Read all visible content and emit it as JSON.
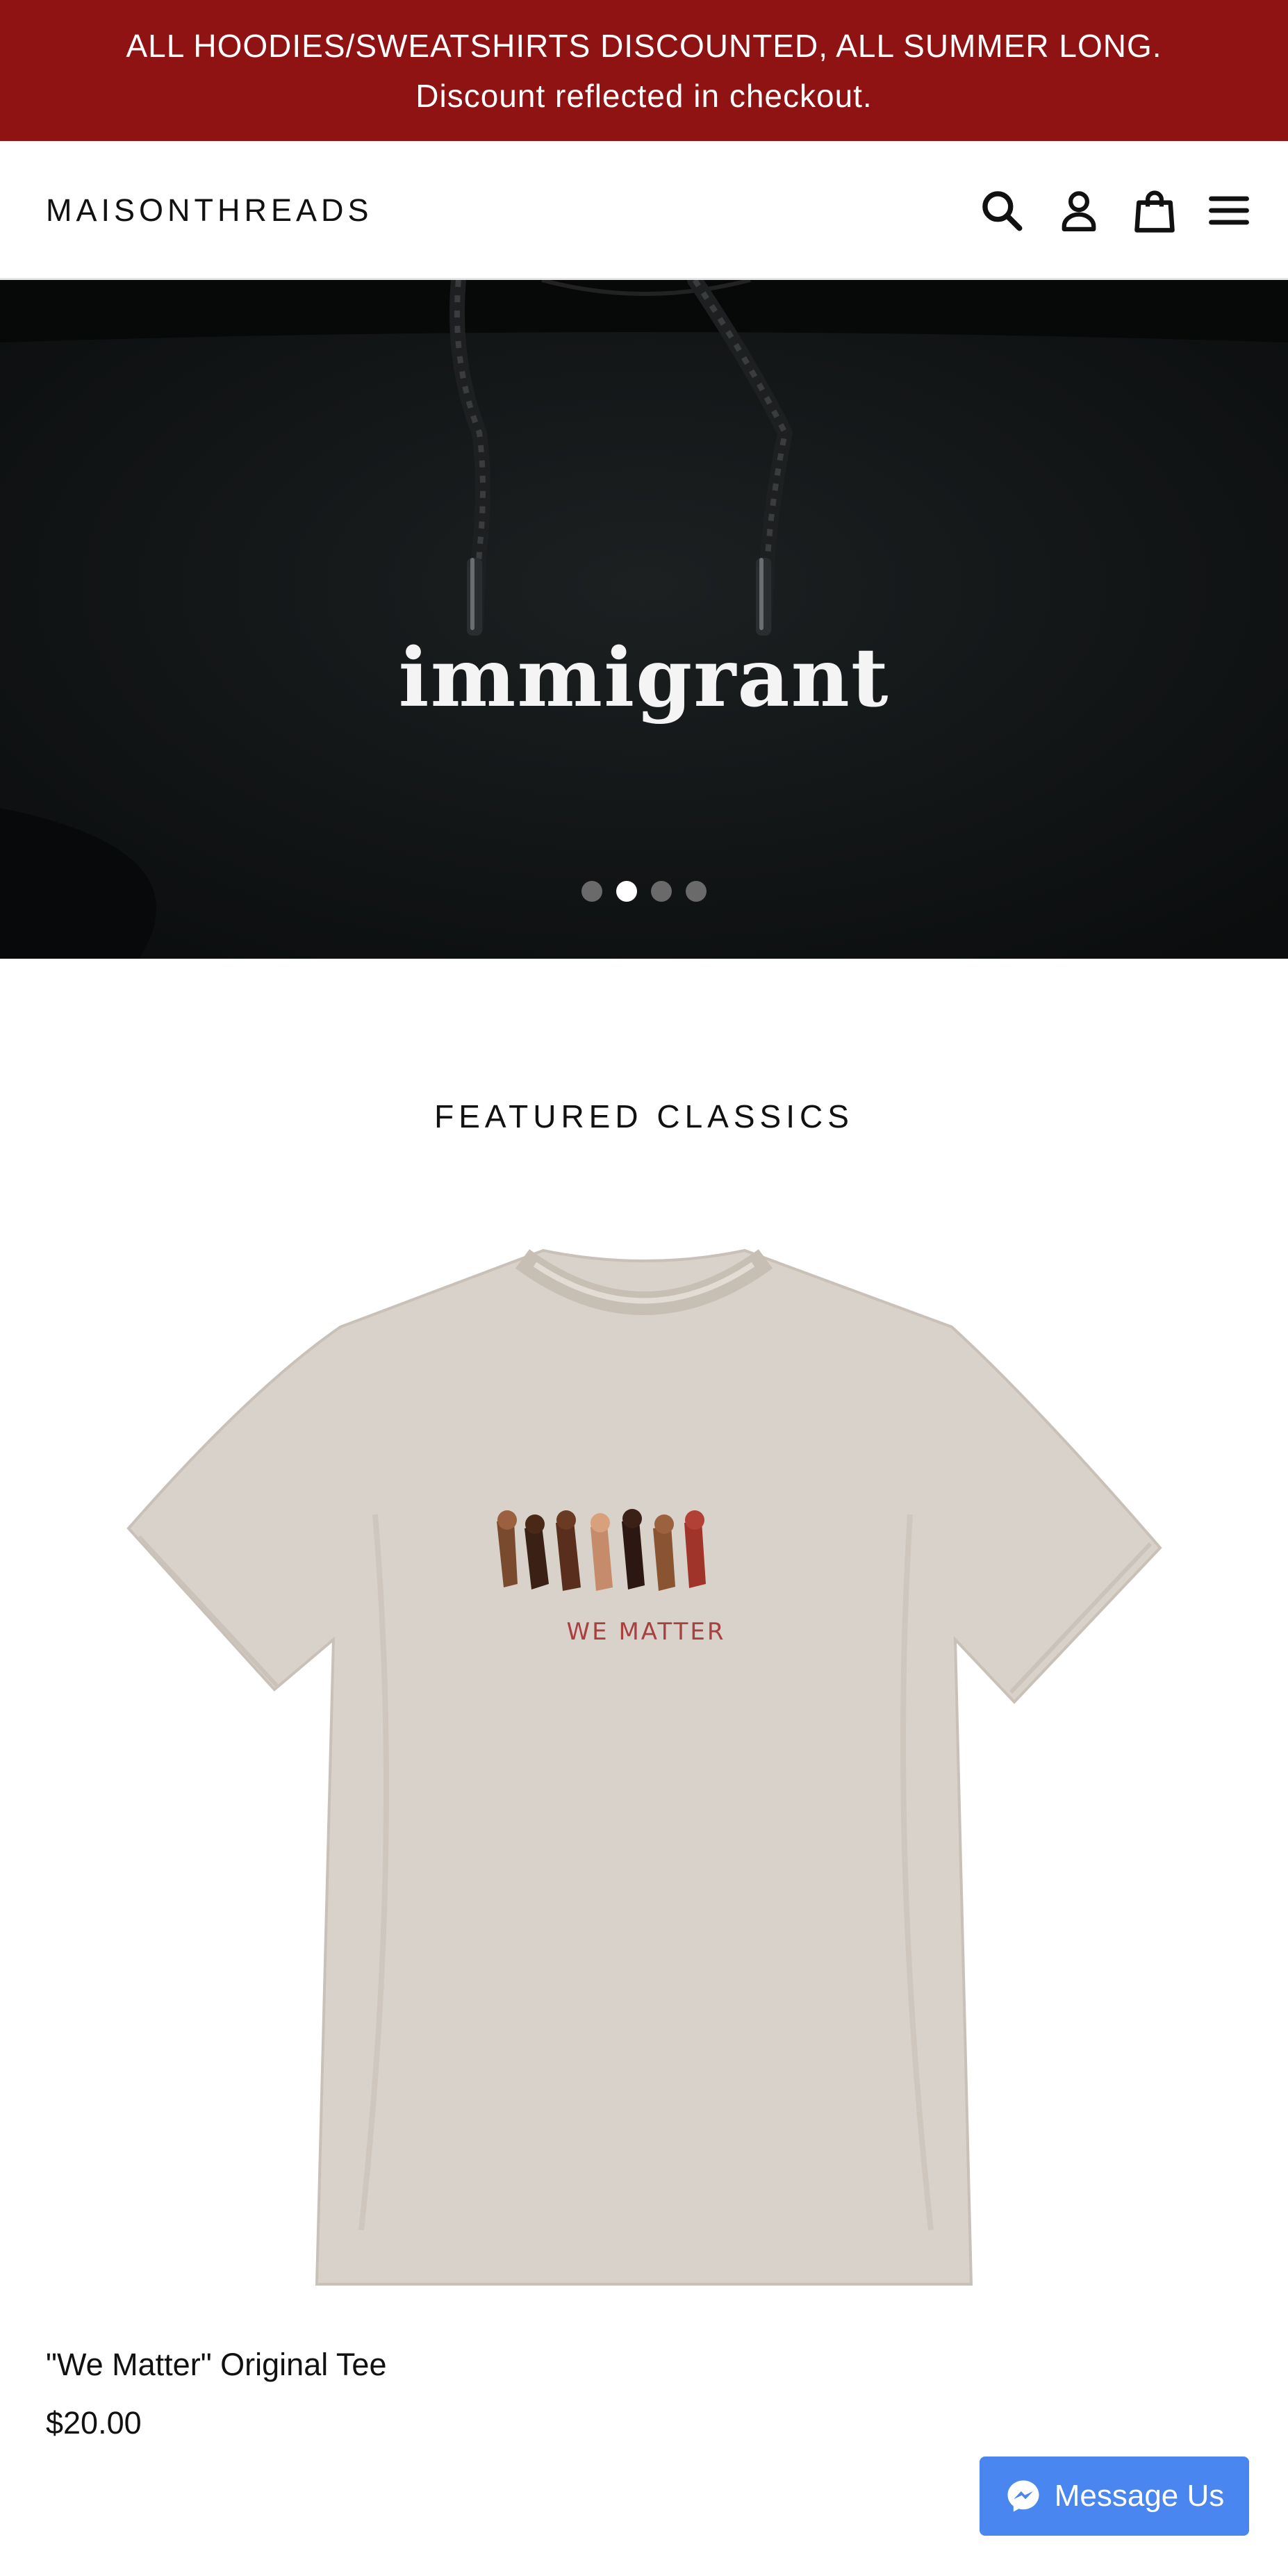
{
  "announcement": {
    "line1": "ALL HOODIES/SWEATSHIRTS DISCOUNTED, ALL SUMMER LONG.",
    "line2": "Discount reflected in checkout."
  },
  "header": {
    "logo": "MAISONTHREADS",
    "icons": [
      "search-icon",
      "account-icon",
      "cart-icon",
      "menu-icon"
    ]
  },
  "hero": {
    "caption": "immigrant",
    "slide_count": 4,
    "active_slide": 2
  },
  "featured": {
    "title": "FEATURED CLASSICS",
    "products": [
      {
        "image_text": "WE MATTER",
        "name": "\"We Matter\" Original Tee",
        "price": "$20.00"
      }
    ]
  },
  "messenger": {
    "label": "Message Us"
  },
  "colors": {
    "announcement_bg": "#8f1313",
    "hero_bg": "#111415",
    "tee": "#d9d2ca",
    "messenger_bg": "#4a86f0"
  }
}
